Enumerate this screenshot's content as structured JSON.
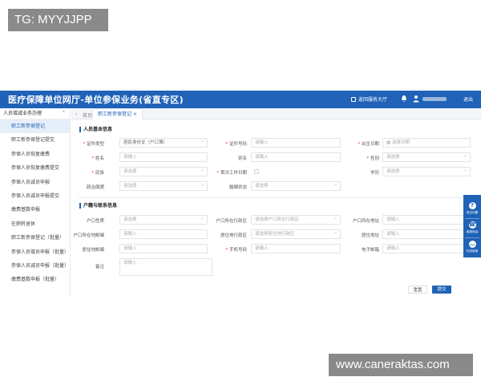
{
  "watermarks": {
    "top_left": "TG: MYYJJPP",
    "bottom_right": "www.caneraktas.com"
  },
  "header": {
    "title": "医疗保障单位网厅-单位参保业务(省直专区)",
    "hall_label": "返回服务大厅",
    "logout_label": "退出"
  },
  "sidebar": {
    "group_label": "人员增减业务办理",
    "items": [
      {
        "label": "职工新参保登记"
      },
      {
        "label": "职工新参保登记提交"
      },
      {
        "label": "参保人员恢复缴费"
      },
      {
        "label": "参保人员恢复缴费提交"
      },
      {
        "label": "参保人员减员申报"
      },
      {
        "label": "参保人员减员申报提交"
      },
      {
        "label": "缴费基数申报"
      },
      {
        "label": "在职转退休"
      },
      {
        "label": "职工新参保登记（批量）"
      },
      {
        "label": "参保人员增员申报（批量）"
      },
      {
        "label": "参保人员减员申报（批量）"
      },
      {
        "label": "缴费基数申报（批量）"
      }
    ]
  },
  "tabbar": {
    "home_label": "首页",
    "active_tab": "职工新参保登记 ×"
  },
  "section_basic": {
    "title": "人员基本信息",
    "fields": {
      "cert_type": {
        "label": "证件类型",
        "value": "居民身份证（户口簿）"
      },
      "cert_no": {
        "label": "证件号码",
        "placeholder": "请输入"
      },
      "birth": {
        "label": "出生日期",
        "placeholder": "选择日期"
      },
      "name": {
        "label": "姓名",
        "placeholder": "请输入"
      },
      "alias": {
        "label": "别名",
        "placeholder": "请输入"
      },
      "gender": {
        "label": "性别",
        "placeholder": "请选择"
      },
      "ethnicity": {
        "label": "民族",
        "placeholder": "请选择"
      },
      "first_work": {
        "label": "首次工作日期"
      },
      "education": {
        "label": "学历",
        "placeholder": "请选择"
      },
      "politics": {
        "label": "政治面貌",
        "placeholder": "请选择"
      },
      "marital": {
        "label": "婚姻状态",
        "placeholder": "请选择"
      }
    }
  },
  "section_contact": {
    "title": "户籍与联系信息",
    "fields": {
      "hukou_nature": {
        "label": "户口性质",
        "placeholder": "请选择"
      },
      "hukou_region": {
        "label": "户口所在行政区",
        "placeholder": "请选择户口所在行政区"
      },
      "hukou_addr": {
        "label": "户口所在地址",
        "placeholder": "请输入"
      },
      "hukou_post": {
        "label": "户口所在地邮编",
        "placeholder": "请输入"
      },
      "live_region": {
        "label": "居住地行政区",
        "placeholder": "请选择居住地行政区"
      },
      "live_addr": {
        "label": "居住地址",
        "placeholder": "请输入"
      },
      "live_post": {
        "label": "居住地邮编",
        "placeholder": "请输入"
      },
      "mobile": {
        "label": "手机号码",
        "placeholder": "请输入"
      },
      "email": {
        "label": "电子邮箱",
        "placeholder": "请输入"
      },
      "remark": {
        "label": "备注",
        "placeholder": "请输入"
      }
    }
  },
  "buttons": {
    "reset": "重置",
    "submit": "提交"
  },
  "float_panel": {
    "items": [
      {
        "label": "常见问题",
        "icon": "?"
      },
      {
        "label": "客服电话",
        "icon": "☎"
      },
      {
        "label": "在线客服",
        "icon": "…"
      }
    ]
  },
  "colors": {
    "brand": "#1f62b7",
    "required": "#e22233"
  }
}
